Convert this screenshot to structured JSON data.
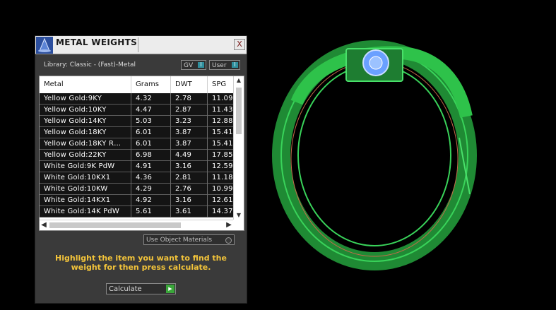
{
  "panel": {
    "title": "METAL WEIGHTS",
    "close_glyph": "X",
    "library_label": "Library: Classic - (Fast)-Metal",
    "toggles": {
      "gv": "GV",
      "user": "User",
      "knob": "I"
    },
    "columns": [
      "Metal",
      "Grams",
      "DWT",
      "SPG"
    ],
    "rows": [
      [
        "Yellow Gold:9KY",
        "4.32",
        "2.78",
        "11.09"
      ],
      [
        "Yellow Gold:10KY",
        "4.47",
        "2.87",
        "11.43"
      ],
      [
        "Yellow Gold:14KY",
        "5.03",
        "3.23",
        "12.88"
      ],
      [
        "Yellow Gold:18KY",
        "6.01",
        "3.87",
        "15.41"
      ],
      [
        "Yellow Gold:18KY R…",
        "6.01",
        "3.87",
        "15.41"
      ],
      [
        "Yellow Gold:22KY",
        "6.98",
        "4.49",
        "17.85"
      ],
      [
        "White Gold:9K PdW",
        "4.91",
        "3.16",
        "12.59"
      ],
      [
        "White Gold:10KX1",
        "4.36",
        "2.81",
        "11.18"
      ],
      [
        "White Gold:10KW",
        "4.29",
        "2.76",
        "10.99"
      ],
      [
        "White Gold:14KX1",
        "4.92",
        "3.16",
        "12.61"
      ],
      [
        "White Gold:14K PdW",
        "5.61",
        "3.61",
        "14.37"
      ]
    ],
    "use_object_materials": "Use Object Materials",
    "hint": "Highlight the item you want to find the weight for then press calculate.",
    "calculate_label": "Calculate"
  },
  "icons": {
    "title": "wizard-hat-icon",
    "close": "close-icon",
    "scroll_up": "▲",
    "scroll_down": "▼",
    "scroll_left": "◀",
    "scroll_right": "▶",
    "calculate": "play-icon"
  },
  "colors": {
    "viewport_bg": "#000000",
    "panel_bg": "#3a3a3a",
    "hint_text": "#f3c43a",
    "ring_green": "#2ec24a",
    "gem_blue": "#6aa0ff",
    "toggle_knob": "#2f8f9d",
    "calc_go": "#3aa63a"
  }
}
